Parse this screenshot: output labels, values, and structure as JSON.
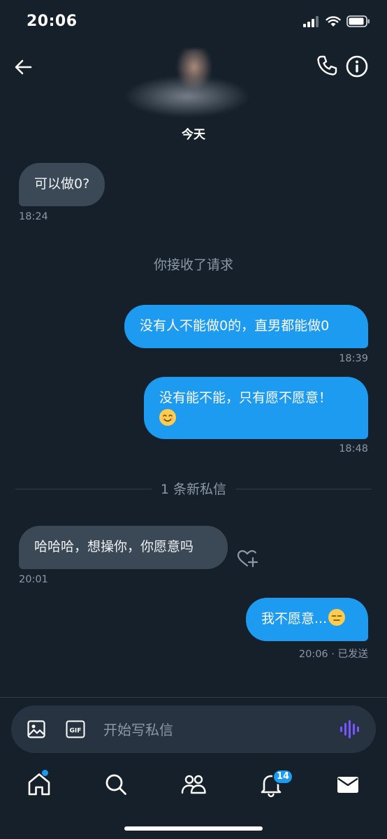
{
  "status_bar": {
    "time": "20:06"
  },
  "header": {
    "date_label": "今天"
  },
  "messages": [
    {
      "text": "可以做0?",
      "time": "18:24"
    },
    {
      "text": "你接收了请求"
    },
    {
      "text": "没有人不能做0的，直男都能做0",
      "time": "18:39"
    },
    {
      "text_line1": "没有能不能，只有愿不愿意！",
      "time": "18:48"
    },
    {
      "text": "1 条新私信"
    },
    {
      "text": "哈哈哈，想操你，你愿意吗",
      "time": "20:01"
    },
    {
      "text": "我不愿意...",
      "time": "20:06 · 已发送"
    }
  ],
  "composer": {
    "placeholder": "开始写私信"
  },
  "tabbar": {
    "notifications_badge": "14"
  },
  "colors": {
    "accent": "#1d9bf0",
    "background": "#15202b",
    "incoming_bubble": "#3b4856",
    "muted_text": "#8b98a5",
    "voice_icon": "#7856ff"
  },
  "icons": [
    "back-arrow-icon",
    "phone-icon",
    "info-icon",
    "heart-plus-icon",
    "image-icon",
    "gif-icon",
    "voice-icon",
    "home-icon",
    "search-icon",
    "communities-icon",
    "bell-icon",
    "mail-icon"
  ]
}
